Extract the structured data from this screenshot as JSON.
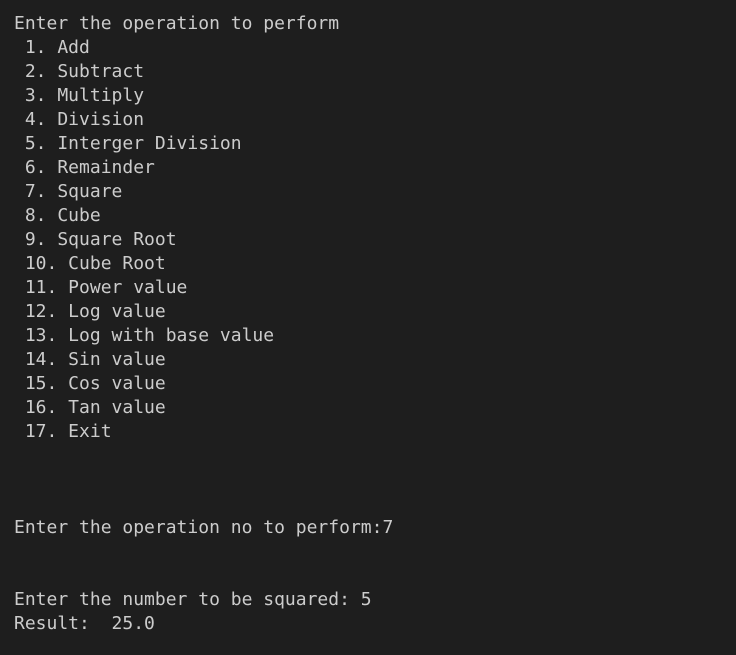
{
  "terminal": {
    "header": "Enter the operation to perform",
    "menu": [
      " 1. Add",
      " 2. Subtract",
      " 3. Multiply",
      " 4. Division",
      " 5. Interger Division",
      " 6. Remainder",
      " 7. Square",
      " 8. Cube",
      " 9. Square Root",
      " 10. Cube Root",
      " 11. Power value",
      " 12. Log value",
      " 13. Log with base value",
      " 14. Sin value",
      " 15. Cos value",
      " 16. Tan value",
      " 17. Exit"
    ],
    "prompt_operation": "Enter the operation no to perform:7",
    "prompt_number": "Enter the number to be squared: 5",
    "result": "Result:  25.0"
  }
}
